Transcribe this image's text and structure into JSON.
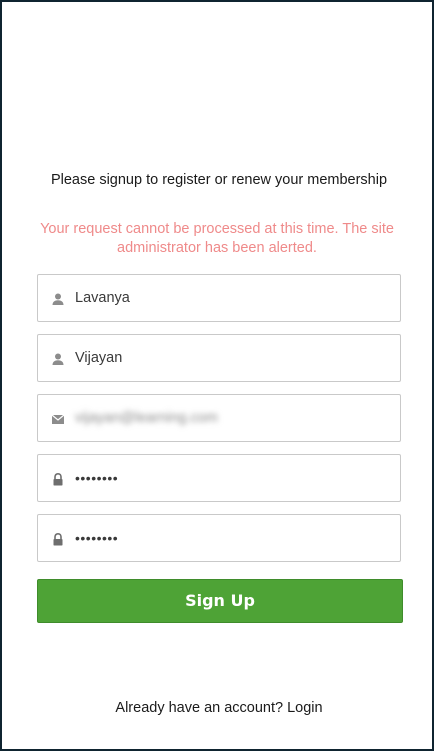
{
  "intro_text": "Please signup to register or renew your membership",
  "error_text": "Your request cannot be processed at this time. The site administrator has been alerted.",
  "fields": {
    "first_name": {
      "value": "Lavanya",
      "icon": "user-icon"
    },
    "last_name": {
      "value": "Vijayan",
      "icon": "user-icon"
    },
    "email": {
      "value": "vijayan@learning.com",
      "icon": "envelope-icon"
    },
    "password": {
      "value": "••••••••",
      "icon": "lock-icon"
    },
    "confirm_password": {
      "value": "••••••••",
      "icon": "lock-icon"
    }
  },
  "signup_label": "Sign Up",
  "footer": {
    "prompt": "Already have an account?",
    "login_label": "Login"
  },
  "colors": {
    "accent": "#4ea336",
    "error": "#ef8a8a",
    "border": "#0f2430"
  }
}
